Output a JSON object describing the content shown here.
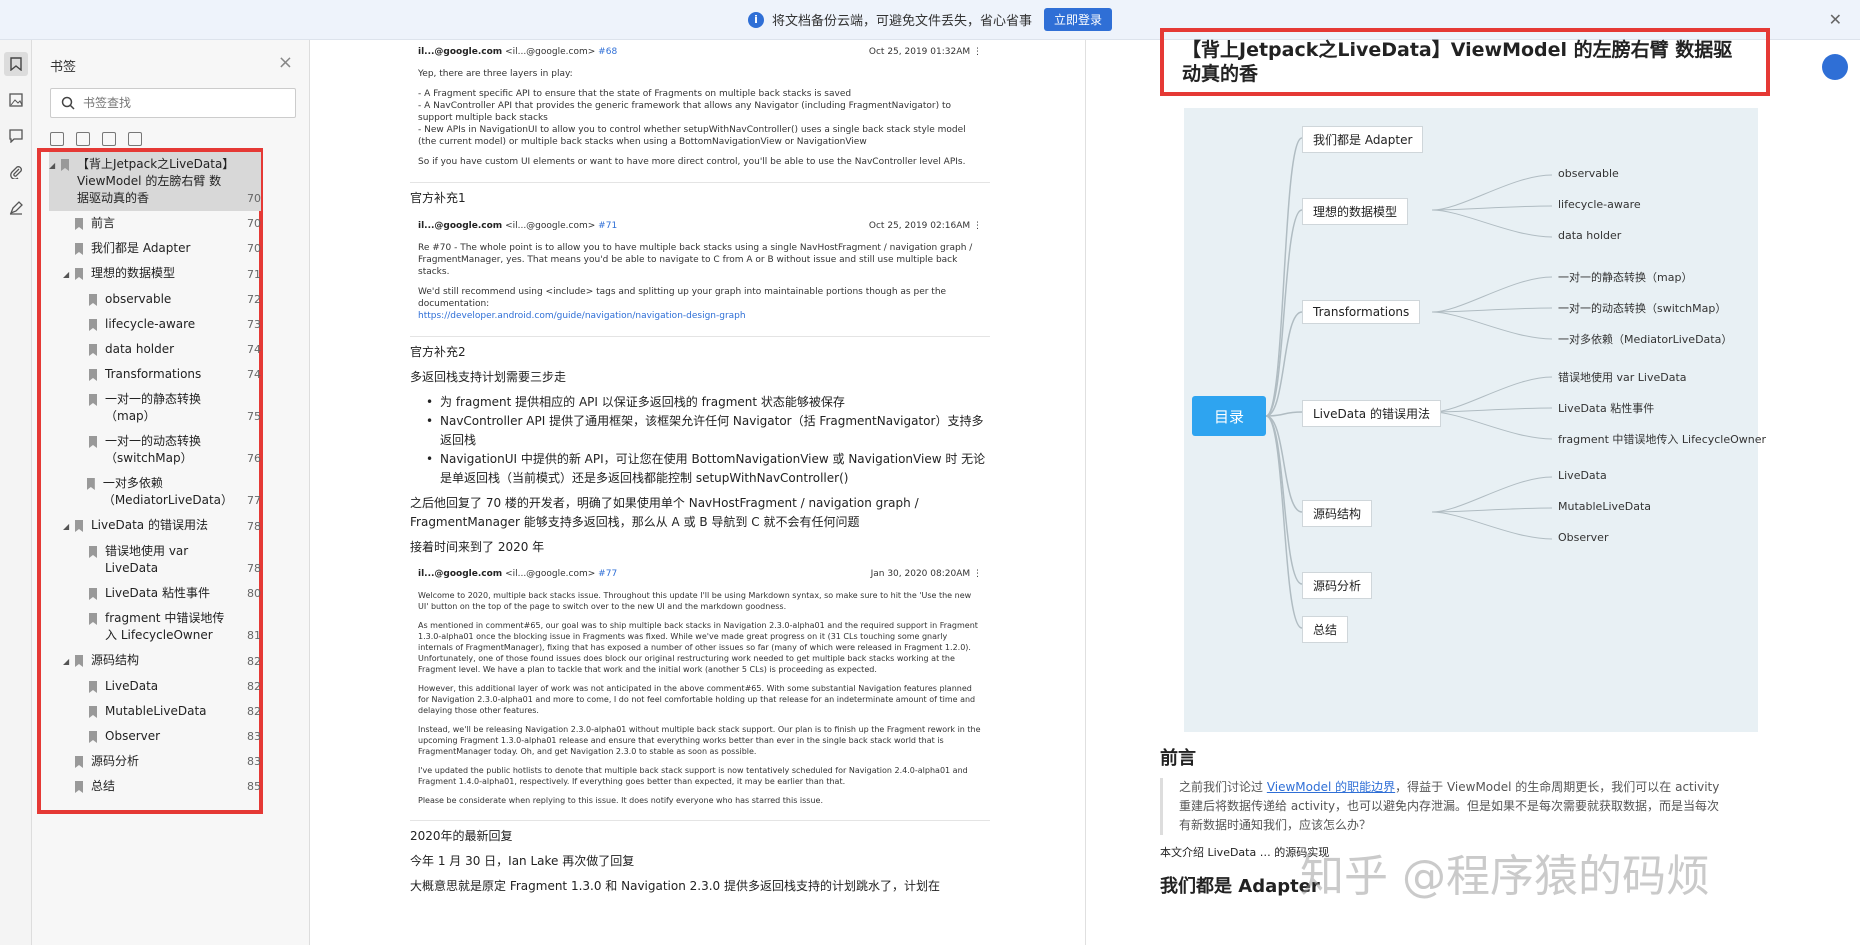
{
  "banner": {
    "text": "将文档备份云端，可避免文件丢失，省心省事",
    "login": "立即登录"
  },
  "sidebar": {
    "title": "书签",
    "search_placeholder": "书签查找",
    "items": [
      {
        "label": "【背上Jetpack之LiveData】ViewModel 的左膀右臂 数据驱动真的香",
        "page": "70",
        "level": 0
      },
      {
        "label": "前言",
        "page": "70",
        "level": 1
      },
      {
        "label": "我们都是 Adapter",
        "page": "70",
        "level": 1
      },
      {
        "label": "理想的数据模型",
        "page": "71",
        "level": 1
      },
      {
        "label": "observable",
        "page": "72",
        "level": 2
      },
      {
        "label": "lifecycle-aware",
        "page": "73",
        "level": 2
      },
      {
        "label": "data holder",
        "page": "74",
        "level": 2
      },
      {
        "label": "Transformations",
        "page": "74",
        "level": 2
      },
      {
        "label": "一对一的静态转换（map）",
        "page": "75",
        "level": 2
      },
      {
        "label": "一对一的动态转换（switchMap）",
        "page": "76",
        "level": 2
      },
      {
        "label": "一对多依赖（MediatorLiveData）",
        "page": "77",
        "level": 2
      },
      {
        "label": "LiveData 的错误用法",
        "page": "78",
        "level": 1
      },
      {
        "label": "错误地使用 var LiveData",
        "page": "78",
        "level": 2
      },
      {
        "label": "LiveData 粘性事件",
        "page": "80",
        "level": 2
      },
      {
        "label": "fragment 中错误地传入 LifecycleOwner",
        "page": "81",
        "level": 2
      },
      {
        "label": "源码结构",
        "page": "82",
        "level": 1
      },
      {
        "label": "LiveData",
        "page": "82",
        "level": 2
      },
      {
        "label": "MutableLiveData",
        "page": "82",
        "level": 2
      },
      {
        "label": "Observer",
        "page": "83",
        "level": 2
      },
      {
        "label": "源码分析",
        "page": "83",
        "level": 1
      },
      {
        "label": "总结",
        "page": "85",
        "level": 1
      }
    ]
  },
  "left_page": {
    "card1": {
      "author": "il...@google.com",
      "email": "<il...@google.com>",
      "num": "#68",
      "date": "Oct 25, 2019 01:32AM",
      "lines": [
        "Yep, there are three layers in play:",
        "- A Fragment specific API to ensure that the state of Fragments on multiple back stacks is saved",
        "- A NavController API that provides the generic framework that allows any Navigator (including FragmentNavigator) to support multiple back stacks",
        "- New APIs in NavigationUI to allow you to control whether setupWithNavController() uses a single back stack style model (the current model) or multiple back stacks when using a BottomNavigationView or NavigationView",
        "So if you have custom UI elements or want to have more direct control, you'll be able to use the NavController level APIs."
      ]
    },
    "sup1": "官方补充1",
    "card2": {
      "author": "il...@google.com",
      "email": "<il...@google.com>",
      "num": "#71",
      "date": "Oct 25, 2019 02:16AM",
      "lines": [
        "Re #70 - The whole point is to allow you to have multiple back stacks using a single NavHostFragment / navigation graph / FragmentManager, yes. That means you'd be able to navigate to C from A or B without issue and still use multiple back stacks.",
        "We'd still recommend using <include> tags and splitting up your graph into maintainable portions though as per the documentation:"
      ],
      "link": "https://developer.android.com/guide/navigation/navigation-design-graph"
    },
    "sup2": "官方补充2",
    "steps_title": "多返回栈支持计划需要三步走",
    "bullets": [
      "为 fragment 提供相应的 API 以保证多返回栈的 fragment 状态能够被保存",
      "NavController API 提供了通用框架，该框架允许任何 Navigator（括 FragmentNavigator）支持多返回栈",
      "NavigationUI 中提供的新 API，可让您在使用 BottomNavigationView 或 NavigationView 时 无论是单返回栈（当前模式）还是多返回栈都能控制 setupWithNavController()"
    ],
    "para1": "之后他回复了 70 楼的开发者，明确了如果使用单个 NavHostFragment / navigation graph / FragmentManager 能够支持多返回栈，那么从 A 或 B 导航到 C 就不会有任何问题",
    "para2": "接着时间来到了 2020 年",
    "card3": {
      "author": "il...@google.com",
      "email": "<il...@google.com>",
      "num": "#77",
      "date": "Jan 30, 2020 08:20AM",
      "lines": [
        "Welcome to 2020, multiple back stacks issue. Throughout this update I'll be using Markdown syntax, so make sure to hit the 'Use the new UI' button on the top of the page to switch over to the new UI and the markdown goodness.",
        "As mentioned in comment#65, our goal was to ship multiple back stacks in Navigation 2.3.0-alpha01 and the required support in Fragment 1.3.0-alpha01 once the blocking issue in Fragments was fixed. While we've made great progress on it (31 CLs touching some gnarly internals of FragmentManager), fixing that has exposed a number of other issues so far (many of which were released in Fragment 1.2.0). Unfortunately, one of those found issues does block our original restructuring work needed to get multiple back stacks working at the Fragment level. We have a plan to tackle that work and the initial work (another 5 CLs) is proceeding as expected.",
        "However, this additional layer of work was not anticipated in the above comment#65. With some substantial Navigation features planned for Navigation 2.3.0-alpha01 and more to come, I do not feel comfortable holding up that release for an indeterminate amount of time and delaying those other features.",
        "Instead, we'll be releasing Navigation 2.3.0-alpha01 without multiple back stack support. Our plan is to finish up the Fragment rework in the upcoming Fragment 1.3.0-alpha01 release and ensure that everything works better than ever in the single back stack world that is FragmentManager today. Oh, and get Navigation 2.3.0 to stable as soon as possible.",
        "I've updated the public hotlists to denote that multiple back stack support is now tentatively scheduled for Navigation 2.4.0-alpha01 and Fragment 1.4.0-alpha01, respectively. If everything goes better than expected, it may be earlier than that.",
        "Please be considerate when replying to this issue. It does notify everyone who has starred this issue."
      ]
    },
    "para3": "2020年的最新回复",
    "para4": "今年 1 月 30 日，Ian Lake 再次做了回复",
    "para5": "大概意思就是原定 Fragment 1.3.0 和 Navigation 2.3.0 提供多返回栈支持的计划跳水了，计划在"
  },
  "right_page": {
    "title": "【背上Jetpack之LiveData】ViewModel 的左膀右臂 数据驱动真的香",
    "mindmap": {
      "root": "目录",
      "branches": [
        {
          "label": "我们都是 Adapter",
          "children": []
        },
        {
          "label": "理想的数据模型",
          "children": [
            "observable",
            "lifecycle-aware",
            "data holder"
          ]
        },
        {
          "label": "Transformations",
          "children": [
            "一对一的静态转换（map）",
            "一对一的动态转换（switchMap）",
            "一对多依赖（MediatorLiveData）"
          ]
        },
        {
          "label": "LiveData 的错误用法",
          "children": [
            "错误地使用 var LiveData",
            "LiveData 粘性事件",
            "fragment 中错误地传入 LifecycleOwner"
          ]
        },
        {
          "label": "源码结构",
          "children": [
            "LiveData",
            "MutableLiveData",
            "Observer"
          ]
        },
        {
          "label": "源码分析",
          "children": []
        },
        {
          "label": "总结",
          "children": []
        }
      ]
    },
    "h_preface": "前言",
    "quote_pre": "之前我们讨论过 ",
    "quote_link": "ViewModel 的职能边界",
    "quote_rest": "，得益于 ViewModel 的生命周期更长，我们可以在 activity 重建后将数据传递给 activity，也可以避免内存泄漏。但是如果不是每次需要就获取数据，而是当每次有新数据时通知我们，应该怎么办？",
    "intro": "本文介绍 LiveData … 的源码实现",
    "h_adapter": "我们都是 Adapter",
    "watermark": "知乎 @程序猿的码烦"
  }
}
